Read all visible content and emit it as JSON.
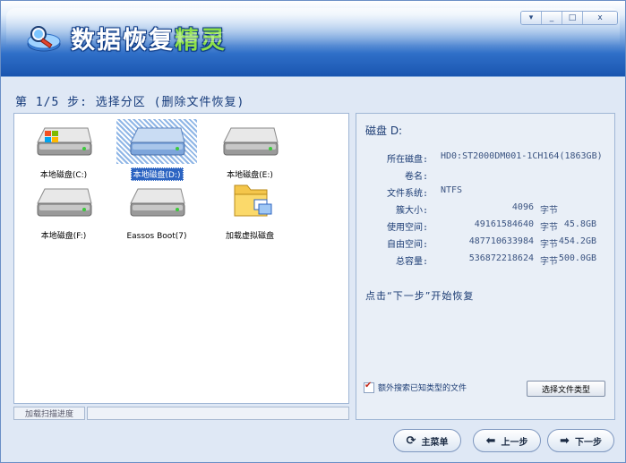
{
  "app": {
    "title_main": "数据恢复",
    "title_accent": "精灵"
  },
  "window_controls": {
    "menu": "▾",
    "minimize": "_",
    "maximize": "□",
    "close": "x"
  },
  "step_label": "第 1/5 步: 选择分区 (删除文件恢复)",
  "drives": [
    {
      "label": "本地磁盘(C:)",
      "selected": false,
      "type": "windows-drive"
    },
    {
      "label": "本地磁盘(D:)",
      "selected": true,
      "type": "drive"
    },
    {
      "label": "本地磁盘(E:)",
      "selected": false,
      "type": "drive"
    },
    {
      "label": "本地磁盘(F:)",
      "selected": false,
      "type": "drive"
    },
    {
      "label": "Eassos Boot(7)",
      "selected": false,
      "type": "drive"
    },
    {
      "label": "加载虚拟磁盘",
      "selected": false,
      "type": "folder"
    }
  ],
  "info": {
    "title": "磁盘 D:",
    "disk_label": "所在磁盘:",
    "disk_value": "HD0:ST2000DM001-1CH164(1863GB)",
    "volume_label": "卷名:",
    "volume_value": "",
    "fs_label": "文件系统:",
    "fs_value": "NTFS",
    "cluster_label": "簇大小:",
    "cluster_num": "4096",
    "cluster_unit": "字节",
    "used_label": "使用空间:",
    "used_num": "49161584640",
    "used_unit": "字节",
    "used_gb": "45.8GB",
    "free_label": "自由空间:",
    "free_num": "487710633984",
    "free_unit": "字节",
    "free_gb": "454.2GB",
    "total_label": "总容量:",
    "total_num": "536872218624",
    "total_unit": "字节",
    "total_gb": "500.0GB",
    "hint": "点击“下一步”开始恢复",
    "extra_search_label": "额外搜索已知类型的文件",
    "extra_search_checked": true,
    "filetype_button": "选择文件类型"
  },
  "progress": {
    "label": "加载扫描进度",
    "value": 0
  },
  "nav": {
    "main_menu": "主菜单",
    "prev": "上一步",
    "next": "下一步"
  },
  "colors": {
    "titlebar": "#1a55b0",
    "accent_green": "#8ee04a",
    "selection": "#2c64c2",
    "text_blue": "#1c3c74"
  }
}
